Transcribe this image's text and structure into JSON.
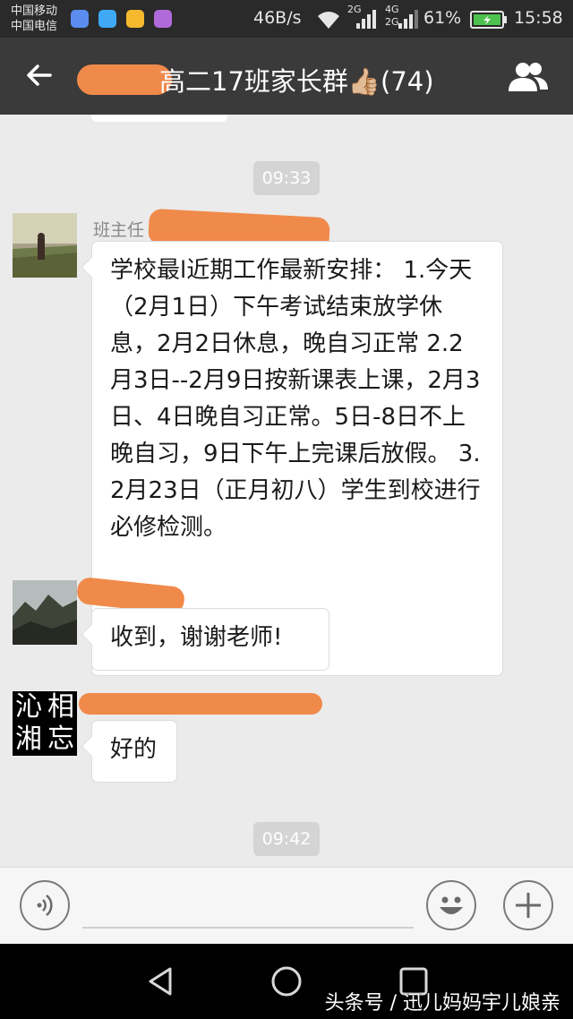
{
  "status_bar": {
    "carrier_1": "中国移动",
    "carrier_2": "中国电信",
    "net_speed": "46B/s",
    "network_2g": "2G",
    "network_4g": "4G",
    "network_2g_b": "2G",
    "battery_percent": "61%",
    "time": "15:58",
    "app_icon_colors": [
      "#5b8def",
      "#3fa9f5",
      "#f5b82e",
      "#b06ad9"
    ]
  },
  "header": {
    "title": "高二17班家长群👍🏼(74)",
    "back_icon": "back-arrow-icon",
    "members_icon": "group-members-icon"
  },
  "chat": {
    "timestamps": [
      "09:33",
      "09:42"
    ],
    "messages": [
      {
        "sender": "班主任",
        "text": "学校最l近期工作最新安排： 1.今天（2月1日）下午考试结束放学休息，2月2日休息，晚自习正常 2.2月3日--2月9日按新课表上课，2月3日、4日晚自习正常。5日-8日不上晚自习，9日下午上完课后放假。 3.2月23日（正月初八）学生到校进行必修检测。"
      },
      {
        "sender": "",
        "text": "收到，谢谢老师!"
      },
      {
        "sender": "",
        "text": "好的",
        "avatar_text": [
          "沁",
          "相",
          "湘",
          "忘"
        ]
      }
    ]
  },
  "input_bar": {
    "voice_icon": "voice-input-icon",
    "emoji_icon": "emoji-icon",
    "plus_icon": "plus-icon"
  },
  "watermark": "头条号 / 迅儿妈妈宇儿娘亲",
  "colors": {
    "redaction": "#f08a4b",
    "titlebar": "#3a3a3a",
    "chat_bg": "#ebebeb"
  }
}
